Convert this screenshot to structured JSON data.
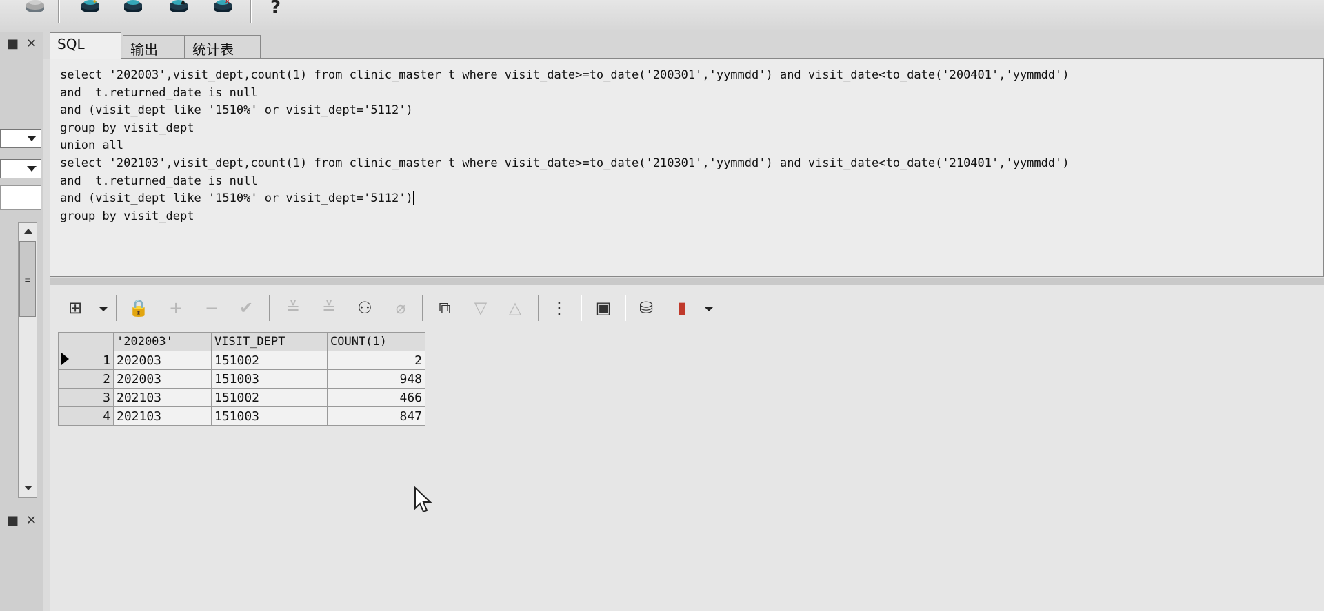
{
  "toolbar": {
    "icons": [
      "db-connect-icon",
      "db-icon",
      "db-export-icon",
      "db-delete-icon",
      "help-icon"
    ],
    "help_label": "?"
  },
  "left_panel": {
    "pin_glyph": "■",
    "close_glyph": "✕"
  },
  "tabs": [
    {
      "label": "SQL",
      "active": true
    },
    {
      "label": "输出",
      "active": false
    },
    {
      "label": "统计表",
      "active": false
    }
  ],
  "sql_editor": {
    "lines": [
      "select '202003',visit_dept,count(1) from clinic_master t where visit_date>=to_date('200301','yymmdd') and visit_date<to_date('200401','yymmdd')",
      "and  t.returned_date is null",
      "and (visit_dept like '1510%' or visit_dept='5112')",
      "group by visit_dept",
      "union all",
      "select '202103',visit_dept,count(1) from clinic_master t where visit_date>=to_date('210301','yymmdd') and visit_date<to_date('210401','yymmdd')",
      "and  t.returned_date is null",
      "and (visit_dept like '1510%' or visit_dept='5112')",
      "group by visit_dept"
    ]
  },
  "grid_toolbar": {
    "icons": [
      "grid-options-icon",
      "lock-icon",
      "add-row-icon",
      "remove-row-icon",
      "post-icon",
      "fetch-next-icon",
      "fetch-last-icon",
      "find-icon",
      "clear-icon",
      "query-by-example-icon",
      "sort-desc-icon",
      "sort-asc-icon",
      "tree-icon",
      "save-icon",
      "export-icon",
      "chart-icon"
    ]
  },
  "result_grid": {
    "columns": [
      "'202003'",
      "VISIT_DEPT",
      "COUNT(1)"
    ],
    "rows": [
      {
        "num": "1",
        "col1": "202003",
        "col2": "151002",
        "col3": "2"
      },
      {
        "num": "2",
        "col1": "202003",
        "col2": "151003",
        "col3": "948"
      },
      {
        "num": "3",
        "col1": "202103",
        "col2": "151002",
        "col3": "466"
      },
      {
        "num": "4",
        "col1": "202103",
        "col2": "151003",
        "col3": "847"
      }
    ]
  }
}
